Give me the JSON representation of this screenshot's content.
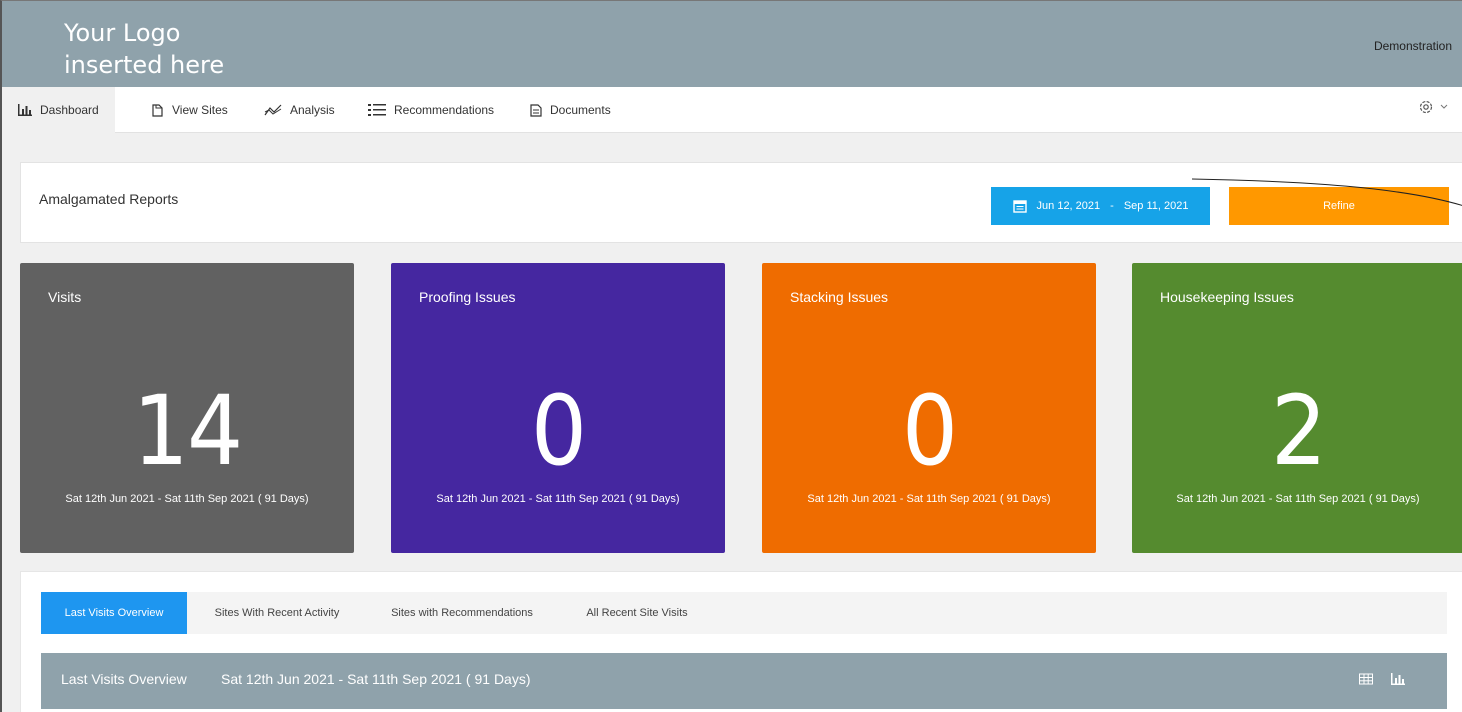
{
  "header": {
    "logo_line1": "Your Logo",
    "logo_line2": "inserted here",
    "user": "Demonstration"
  },
  "nav": {
    "items": [
      {
        "label": "Dashboard",
        "icon": "bar-chart-icon"
      },
      {
        "label": "View Sites",
        "icon": "document-copy-icon"
      },
      {
        "label": "Analysis",
        "icon": "trend-line-icon"
      },
      {
        "label": "Recommendations",
        "icon": "list-icon"
      },
      {
        "label": "Documents",
        "icon": "document-icon"
      }
    ],
    "settings_icon": "gear-icon"
  },
  "reports": {
    "title": "Amalgamated Reports",
    "date_start": "Jun 12, 2021",
    "date_sep": "-",
    "date_end": "Sep 11, 2021",
    "refine_label": "Refine"
  },
  "cards": [
    {
      "title": "Visits",
      "value": "14",
      "range": "Sat 12th Jun 2021 - Sat 11th Sep 2021 ( 91 Days)",
      "color": "#616161"
    },
    {
      "title": "Proofing Issues",
      "value": "0",
      "range": "Sat 12th Jun 2021 - Sat 11th Sep 2021 ( 91 Days)",
      "color": "#4527a0"
    },
    {
      "title": "Stacking Issues",
      "value": "0",
      "range": "Sat 12th Jun 2021 - Sat 11th Sep 2021 ( 91 Days)",
      "color": "#ef6c00"
    },
    {
      "title": "Housekeeping Issues",
      "value": "2",
      "range": "Sat 12th Jun 2021 - Sat 11th Sep 2021 ( 91 Days)",
      "color": "#558b2f"
    }
  ],
  "tabs": [
    {
      "label": "Last Visits Overview",
      "active": true
    },
    {
      "label": "Sites With Recent Activity",
      "active": false
    },
    {
      "label": "Sites with Recommendations",
      "active": false
    },
    {
      "label": "All Recent Site Visits",
      "active": false
    }
  ],
  "overview": {
    "title": "Last Visits Overview",
    "range": "Sat 12th Jun 2021 - Sat 11th Sep 2021 ( 91 Days)",
    "table_icon": "table-icon",
    "chart_icon": "bar-chart-icon"
  }
}
